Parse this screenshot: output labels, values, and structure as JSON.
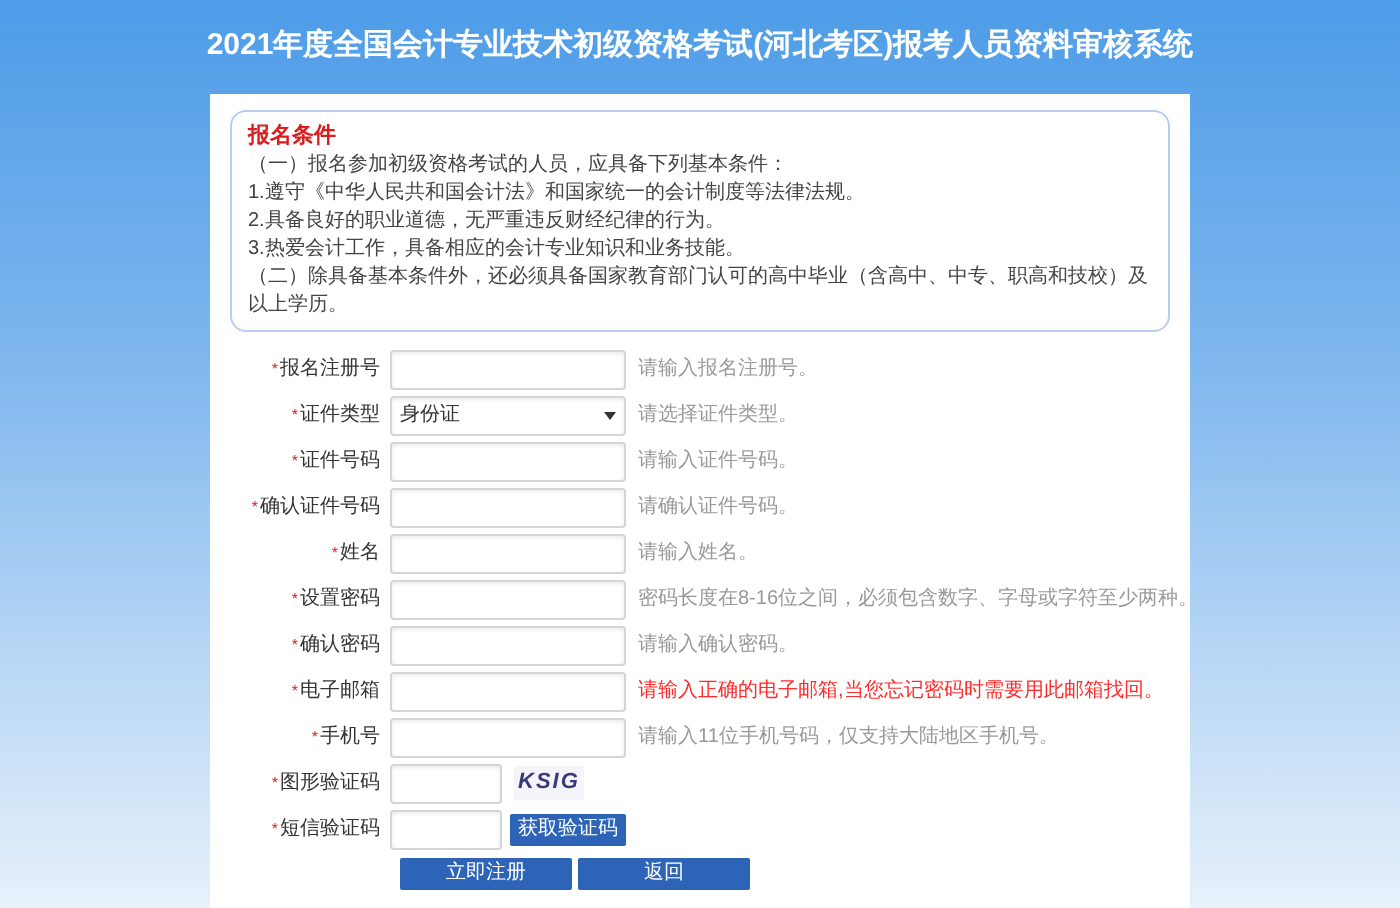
{
  "header": {
    "title": "2021年度全国会计专业技术初级资格考试(河北考区)报考人员资料审核系统"
  },
  "conditions": {
    "title": "报名条件",
    "lines": [
      "（一）报名参加初级资格考试的人员，应具备下列基本条件：",
      "1.遵守《中华人民共和国会计法》和国家统一的会计制度等法律法规。",
      "2.具备良好的职业道德，无严重违反财经纪律的行为。",
      "3.热爱会计工作，具备相应的会计专业知识和业务技能。",
      "（二）除具备基本条件外，还必须具备国家教育部门认可的高中毕业（含高中、中专、职高和技校）及以上学历。"
    ]
  },
  "fields": [
    {
      "kind": "text",
      "label": "报名注册号",
      "mark": "*",
      "hint": "请输入报名注册号。",
      "warning": false
    },
    {
      "kind": "select",
      "label": "证件类型",
      "mark": "*",
      "value": "身份证",
      "hint": "请选择证件类型。",
      "warning": false
    },
    {
      "kind": "text",
      "label": "证件号码",
      "mark": "*",
      "hint": "请输入证件号码。",
      "warning": false
    },
    {
      "kind": "text",
      "label": "确认证件号码",
      "mark": "*",
      "hint": "请确认证件号码。",
      "warning": false
    },
    {
      "kind": "text",
      "label": "姓名",
      "mark": "*",
      "hint": "请输入姓名。",
      "warning": false
    },
    {
      "kind": "text",
      "label": "设置密码",
      "mark": "*",
      "hint": "密码长度在8-16位之间，必须包含数字、字母或字符至少两种。",
      "warning": false
    },
    {
      "kind": "text",
      "label": "确认密码",
      "mark": "*",
      "hint": "请输入确认密码。",
      "warning": false
    },
    {
      "kind": "text",
      "label": "电子邮箱",
      "mark": "*",
      "hint": "请输入正确的电子邮箱,当您忘记密码时需要用此邮箱找回。",
      "warning": true
    },
    {
      "kind": "text",
      "label": "手机号",
      "mark": "*",
      "hint": "请输入11位手机号码，仅支持大陆地区手机号。",
      "warning": false
    },
    {
      "kind": "captcha",
      "label": "图形验证码",
      "mark": "*",
      "captcha": "KSIG"
    },
    {
      "kind": "sms",
      "label": "短信验证码",
      "mark": "*",
      "button": "获取验证码"
    }
  ],
  "buttons": [
    "立即注册",
    "返回"
  ]
}
